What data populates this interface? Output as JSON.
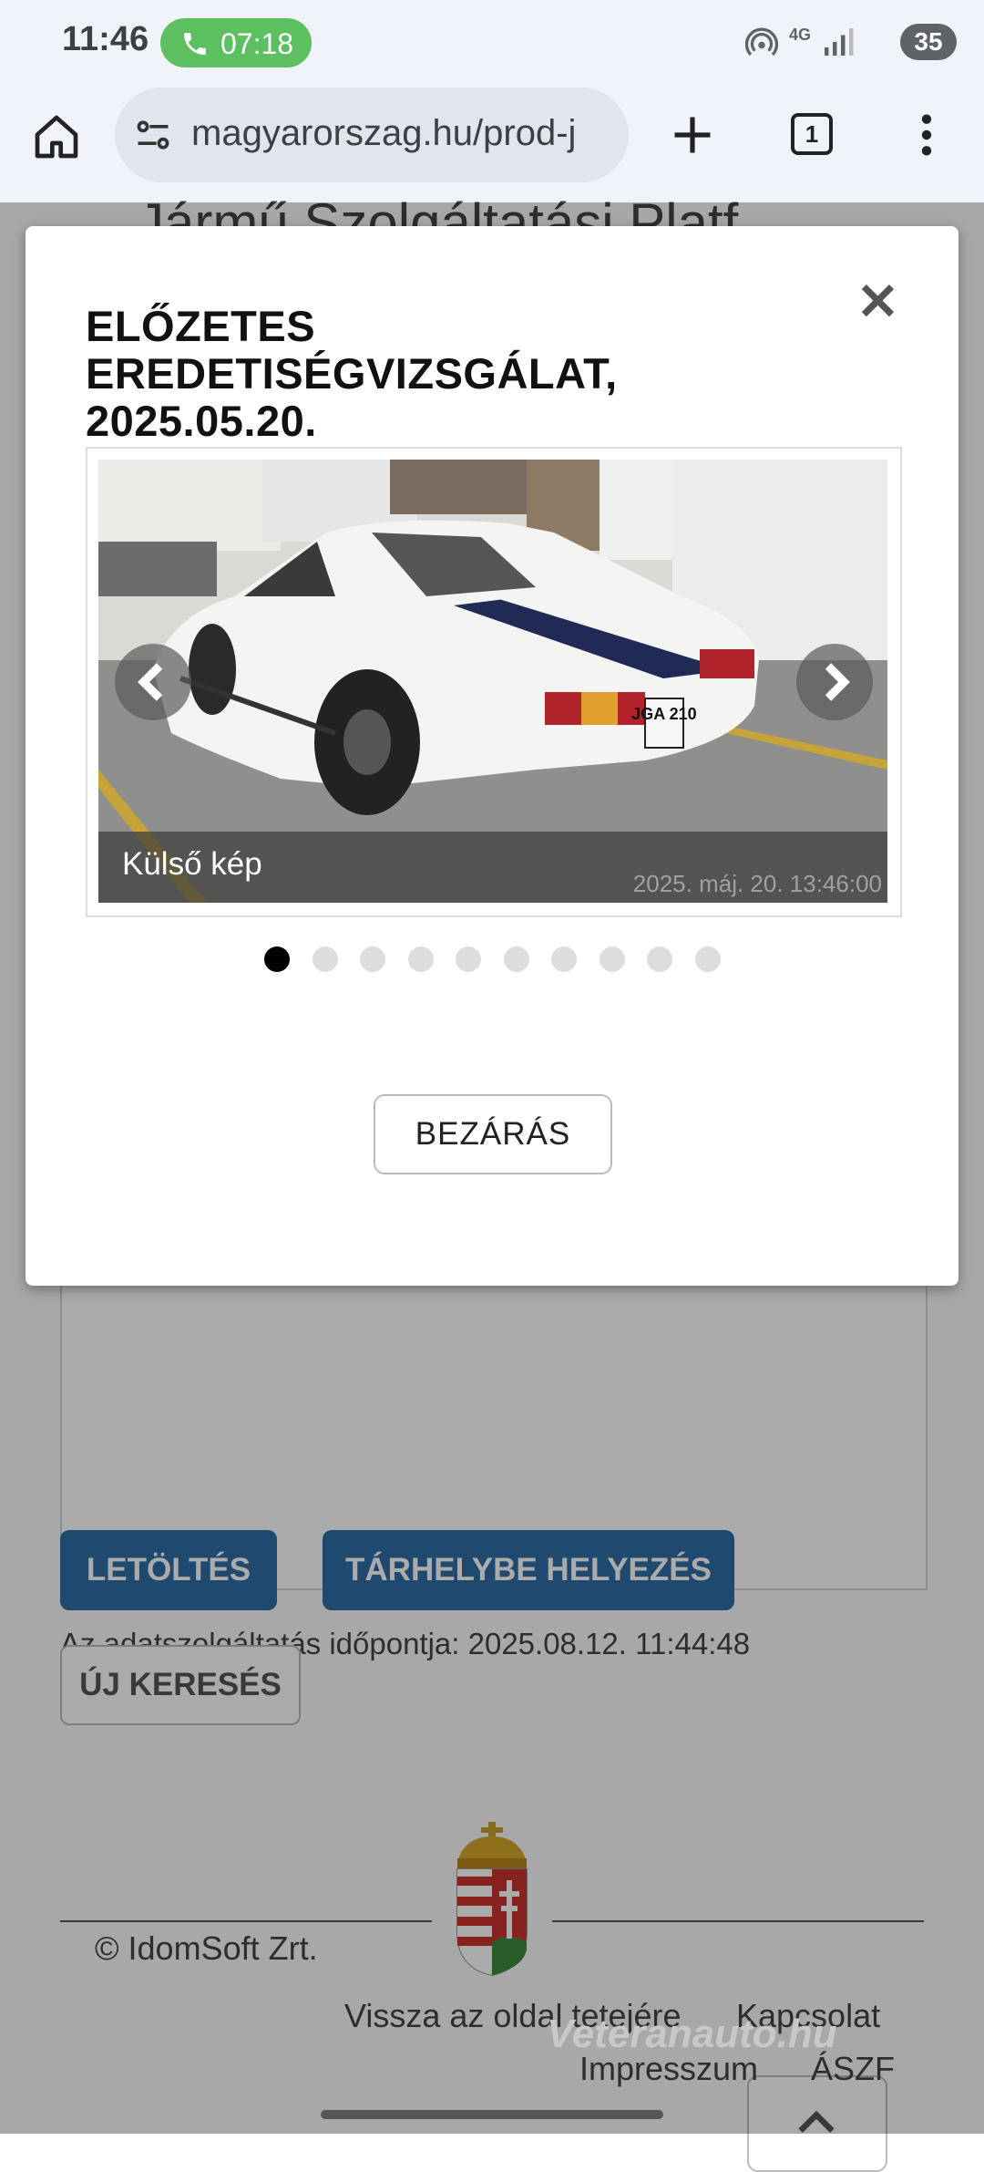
{
  "status_bar": {
    "time": "11:46",
    "call_duration": "07:18",
    "network": "4G",
    "battery": "35"
  },
  "browser": {
    "url": "magyarorszag.hu/prod-j",
    "tab_count": "1"
  },
  "page": {
    "heading": "Jármű Szolgáltatási Platf",
    "timestamp_text": "Az adatszolgáltatás időpontja: 2025.08.12. 11:44:48",
    "download_label": "LETÖLTÉS",
    "storage_label": "TÁRHELYBE HELYEZÉS",
    "new_search_label": "ÚJ KERESÉS",
    "footer": {
      "copyright": "© IdomSoft Zrt.",
      "back_to_top": "Vissza az oldal tetejére",
      "contact": "Kapcsolat",
      "imprint": "Impresszum",
      "terms": "ÁSZF"
    },
    "watermark": "Veteranauto.hu"
  },
  "modal": {
    "title": "ELŐZETES EREDETISÉGVIZSGÁLAT, 2025.05.20.",
    "photo_caption": "Külső kép",
    "photo_timestamp": "2025. máj. 20. 13:46:00",
    "plate_text": "JGA 210",
    "slide_count": 10,
    "active_slide": 1,
    "close_label": "BEZÁRÁS"
  }
}
